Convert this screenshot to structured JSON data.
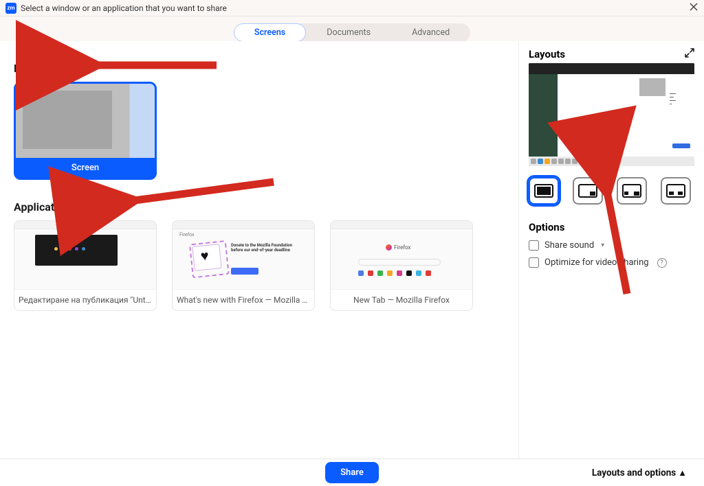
{
  "titlebar": {
    "app_initials": "zm",
    "title": "Select a window or an application that you want to share"
  },
  "tabs": {
    "screens": "Screens",
    "documents": "Documents",
    "advanced": "Advanced"
  },
  "sections": {
    "entire_screen": "Entire screen",
    "application_windows": "Application windows"
  },
  "screen_card": {
    "label": "Screen"
  },
  "windows": [
    {
      "label": "Редактиране на публикация \"Untitled..."
    },
    {
      "label": "What's new with Firefox — Mozilla Firef..."
    },
    {
      "label": "New Tab — Mozilla Firefox"
    }
  ],
  "thumb2": {
    "headline": "Donate to the Mozilla Foundation before our end-of-year deadline",
    "brand": "Firefox"
  },
  "thumb3": {
    "brand": "Firefox"
  },
  "right": {
    "layouts_title": "Layouts",
    "options_title": "Options",
    "share_sound": "Share sound",
    "optimize_video": "Optimize for video sharing"
  },
  "footer": {
    "share": "Share",
    "layouts_toggle": "Layouts and options"
  },
  "colors": {
    "accent": "#0b5cff",
    "arrow": "#d22a1f"
  }
}
